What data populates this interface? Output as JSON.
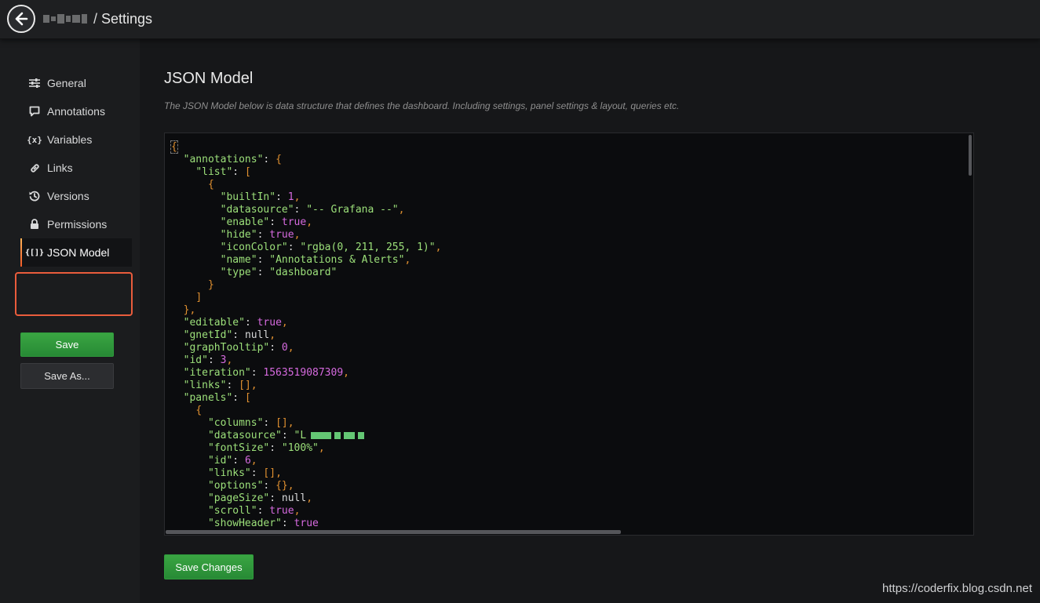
{
  "topbar": {
    "breadcrumb_sep": "/",
    "page": "Settings"
  },
  "sidebar": {
    "items": [
      {
        "label": "General",
        "icon": "sliders-icon"
      },
      {
        "label": "Annotations",
        "icon": "comment-icon"
      },
      {
        "label": "Variables",
        "icon": "variable-icon"
      },
      {
        "label": "Links",
        "icon": "link-icon"
      },
      {
        "label": "Versions",
        "icon": "history-icon"
      },
      {
        "label": "Permissions",
        "icon": "lock-icon"
      },
      {
        "label": "JSON Model",
        "icon": "json-icon",
        "active": true
      }
    ],
    "save_label": "Save",
    "save_as_label": "Save As..."
  },
  "main": {
    "title": "JSON Model",
    "description": "The JSON Model below is data structure that defines the dashboard. Including settings, panel settings & layout, queries etc.",
    "json_lines": [
      "{",
      "  \"annotations\": {",
      "    \"list\": [",
      "      {",
      "        \"builtIn\": 1,",
      "        \"datasource\": \"-- Grafana --\",",
      "        \"enable\": true,",
      "        \"hide\": true,",
      "        \"iconColor\": \"rgba(0, 211, 255, 1)\",",
      "        \"name\": \"Annotations & Alerts\",",
      "        \"type\": \"dashboard\"",
      "      }",
      "    ]",
      "  },",
      "  \"editable\": true,",
      "  \"gnetId\": null,",
      "  \"graphTooltip\": 0,",
      "  \"id\": 3,",
      "  \"iteration\": 1563519087309,",
      "  \"links\": [],",
      "  \"panels\": [",
      "    {",
      "      \"columns\": [],",
      "      \"datasource\": \"L",
      "      \"fontSize\": \"100%\",",
      "      \"id\": 6,",
      "      \"links\": [],",
      "      \"options\": {},",
      "      \"pageSize\": null,",
      "      \"scroll\": true,",
      "      \"showHeader\": true"
    ],
    "save_changes_label": "Save Changes"
  },
  "watermark": "https://coderfix.blog.csdn.net",
  "colors": {
    "accent_green": "#2f9c3c",
    "highlight_red": "#ea5c3c",
    "json_key": "#9ce07a",
    "json_punct": "#e09030",
    "json_number": "#d66adf"
  }
}
